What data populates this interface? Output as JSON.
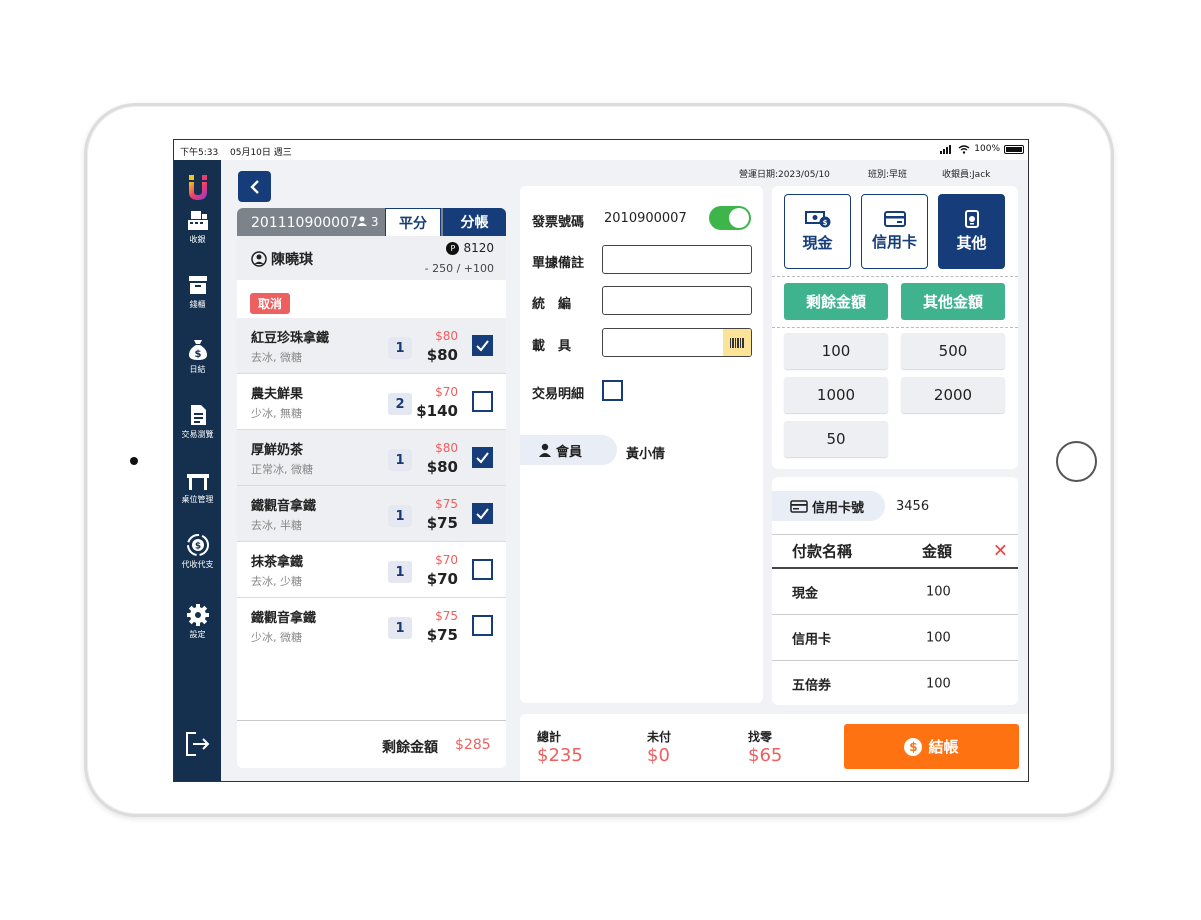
{
  "status_bar": {
    "time": "下午5:33",
    "date": "05月10日 週三",
    "battery": "100%"
  },
  "colors": {
    "navy": "#163d7a",
    "red": "#ee5f5f",
    "green": "#3fb28e",
    "orange": "#fe7211",
    "sidebar": "#15304f"
  },
  "sidebar": {
    "items": [
      {
        "label": "收銀",
        "icon": "cash-register-icon"
      },
      {
        "label": "錢櫃",
        "icon": "drawer-icon"
      },
      {
        "label": "日結",
        "icon": "money-bag-icon"
      },
      {
        "label": "交易瀏覽",
        "icon": "document-icon"
      },
      {
        "label": "桌位管理",
        "icon": "table-icon"
      },
      {
        "label": "代收代支",
        "icon": "exchange-icon"
      },
      {
        "label": "設定",
        "icon": "gear-icon"
      }
    ],
    "logout_icon": "logout-icon"
  },
  "header": {
    "business_date": "營運日期:2023/05/10",
    "shift": "班別:早班",
    "cashier": "收銀員:Jack"
  },
  "order": {
    "number": "201110900007",
    "people": "3",
    "tab_even": "平分",
    "tab_split": "分帳",
    "customer_name": "陳曉琪",
    "points": "8120",
    "points_badge": "P",
    "points_adjust": "- 250 / +100",
    "cancel_label": "取消",
    "items": [
      {
        "name": "紅豆珍珠拿鐵",
        "options": "去冰, 微糖",
        "qty": "1",
        "price": "$80",
        "total": "$80",
        "checked": true
      },
      {
        "name": "農夫鮮果",
        "options": "少冰, 無糖",
        "qty": "2",
        "price": "$70",
        "total": "$140",
        "checked": false
      },
      {
        "name": "厚鮮奶茶",
        "options": "正常冰, 微糖",
        "qty": "1",
        "price": "$80",
        "total": "$80",
        "checked": true
      },
      {
        "name": "鐵觀音拿鐵",
        "options": "去冰, 半糖",
        "qty": "1",
        "price": "$75",
        "total": "$75",
        "checked": true
      },
      {
        "name": "抹茶拿鐵",
        "options": "去冰, 少糖",
        "qty": "1",
        "price": "$70",
        "total": "$70",
        "checked": false
      },
      {
        "name": "鐵觀音拿鐵",
        "options": "少冰, 微糖",
        "qty": "1",
        "price": "$75",
        "total": "$75",
        "checked": false
      }
    ],
    "remaining_label": "剩餘金額",
    "remaining_value": "$285"
  },
  "invoice": {
    "invoice_label": "發票號碼",
    "invoice_number": "2010900007",
    "note_label": "單據備註",
    "tax_id_label": "統　編",
    "carrier_label": "載　具",
    "detail_label": "交易明細",
    "member_label": "會員",
    "member_name": "黃小倩"
  },
  "payment": {
    "methods": [
      {
        "label": "現金",
        "icon": "cash-icon"
      },
      {
        "label": "信用卡",
        "icon": "credit-card-icon"
      },
      {
        "label": "其他",
        "icon": "wallet-icon"
      }
    ],
    "remaining_amount_btn": "剩餘金額",
    "other_amount_btn": "其他金額",
    "amounts": [
      "100",
      "500",
      "1000",
      "2000",
      "50"
    ],
    "card_label": "信用卡號",
    "card_number": "3456",
    "table_headers": {
      "name": "付款名稱",
      "amount": "金額"
    },
    "rows": [
      {
        "name": "現金",
        "amount": "100"
      },
      {
        "name": "信用卡",
        "amount": "100"
      },
      {
        "name": "五倍券",
        "amount": "100"
      }
    ]
  },
  "totals": {
    "total_label": "總計",
    "total_value": "$235",
    "unpaid_label": "未付",
    "unpaid_value": "$0",
    "change_label": "找零",
    "change_value": "$65",
    "checkout_label": "結帳"
  }
}
